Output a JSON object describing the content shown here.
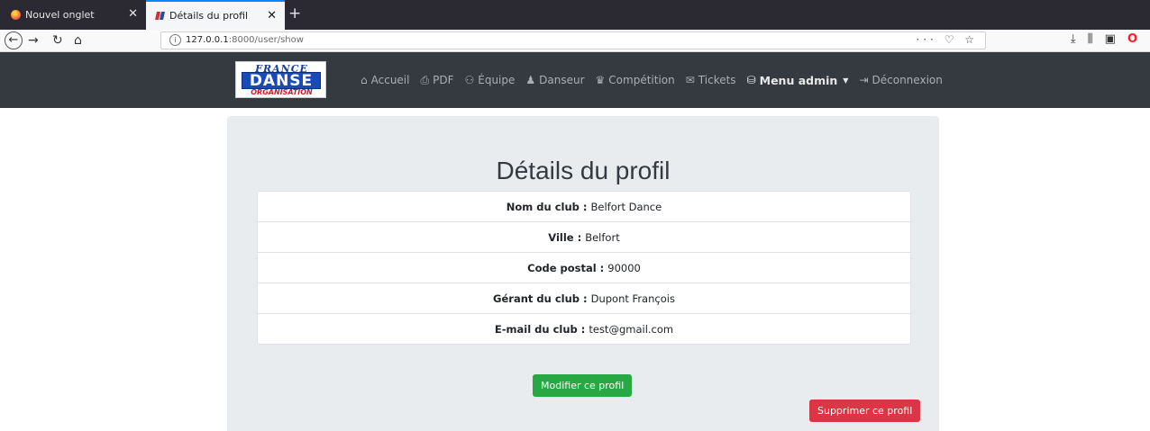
{
  "browser": {
    "tabs": [
      {
        "title": "Nouvel onglet",
        "active": false
      },
      {
        "title": "Détails du profil",
        "active": true
      }
    ],
    "url_host": "127.0.0.1",
    "url_rest": ":8000/user/show"
  },
  "site": {
    "logo": {
      "line1": "FRANCE",
      "line2": "DANSE",
      "line3": "ORGANISATION"
    },
    "menu": [
      {
        "label": "Accueil",
        "icon": "home-icon"
      },
      {
        "label": "PDF",
        "icon": "print-icon"
      },
      {
        "label": "Équipe",
        "icon": "team-icon"
      },
      {
        "label": "Danseur",
        "icon": "dancer-icon"
      },
      {
        "label": "Compétition",
        "icon": "trophy-icon"
      },
      {
        "label": "Tickets",
        "icon": "envelope-icon"
      },
      {
        "label": "Menu admin",
        "icon": "admin-icon"
      },
      {
        "label": "Déconnexion",
        "icon": "logout-icon"
      }
    ]
  },
  "profile": {
    "title": "Détails du profil",
    "fields": [
      {
        "label": "Nom du club :",
        "value": "Belfort Dance"
      },
      {
        "label": "Ville :",
        "value": "Belfort"
      },
      {
        "label": "Code postal :",
        "value": "90000"
      },
      {
        "label": "Gérant du club :",
        "value": "Dupont François"
      },
      {
        "label": "E-mail du club :",
        "value": "test@gmail.com"
      }
    ],
    "edit_button": "Modifier ce profil",
    "delete_button": "Supprimer ce profil"
  },
  "colors": {
    "navbar": "#343a40",
    "edit": "#28a745",
    "delete": "#dc3545",
    "jumbotron": "#e9ecef"
  }
}
